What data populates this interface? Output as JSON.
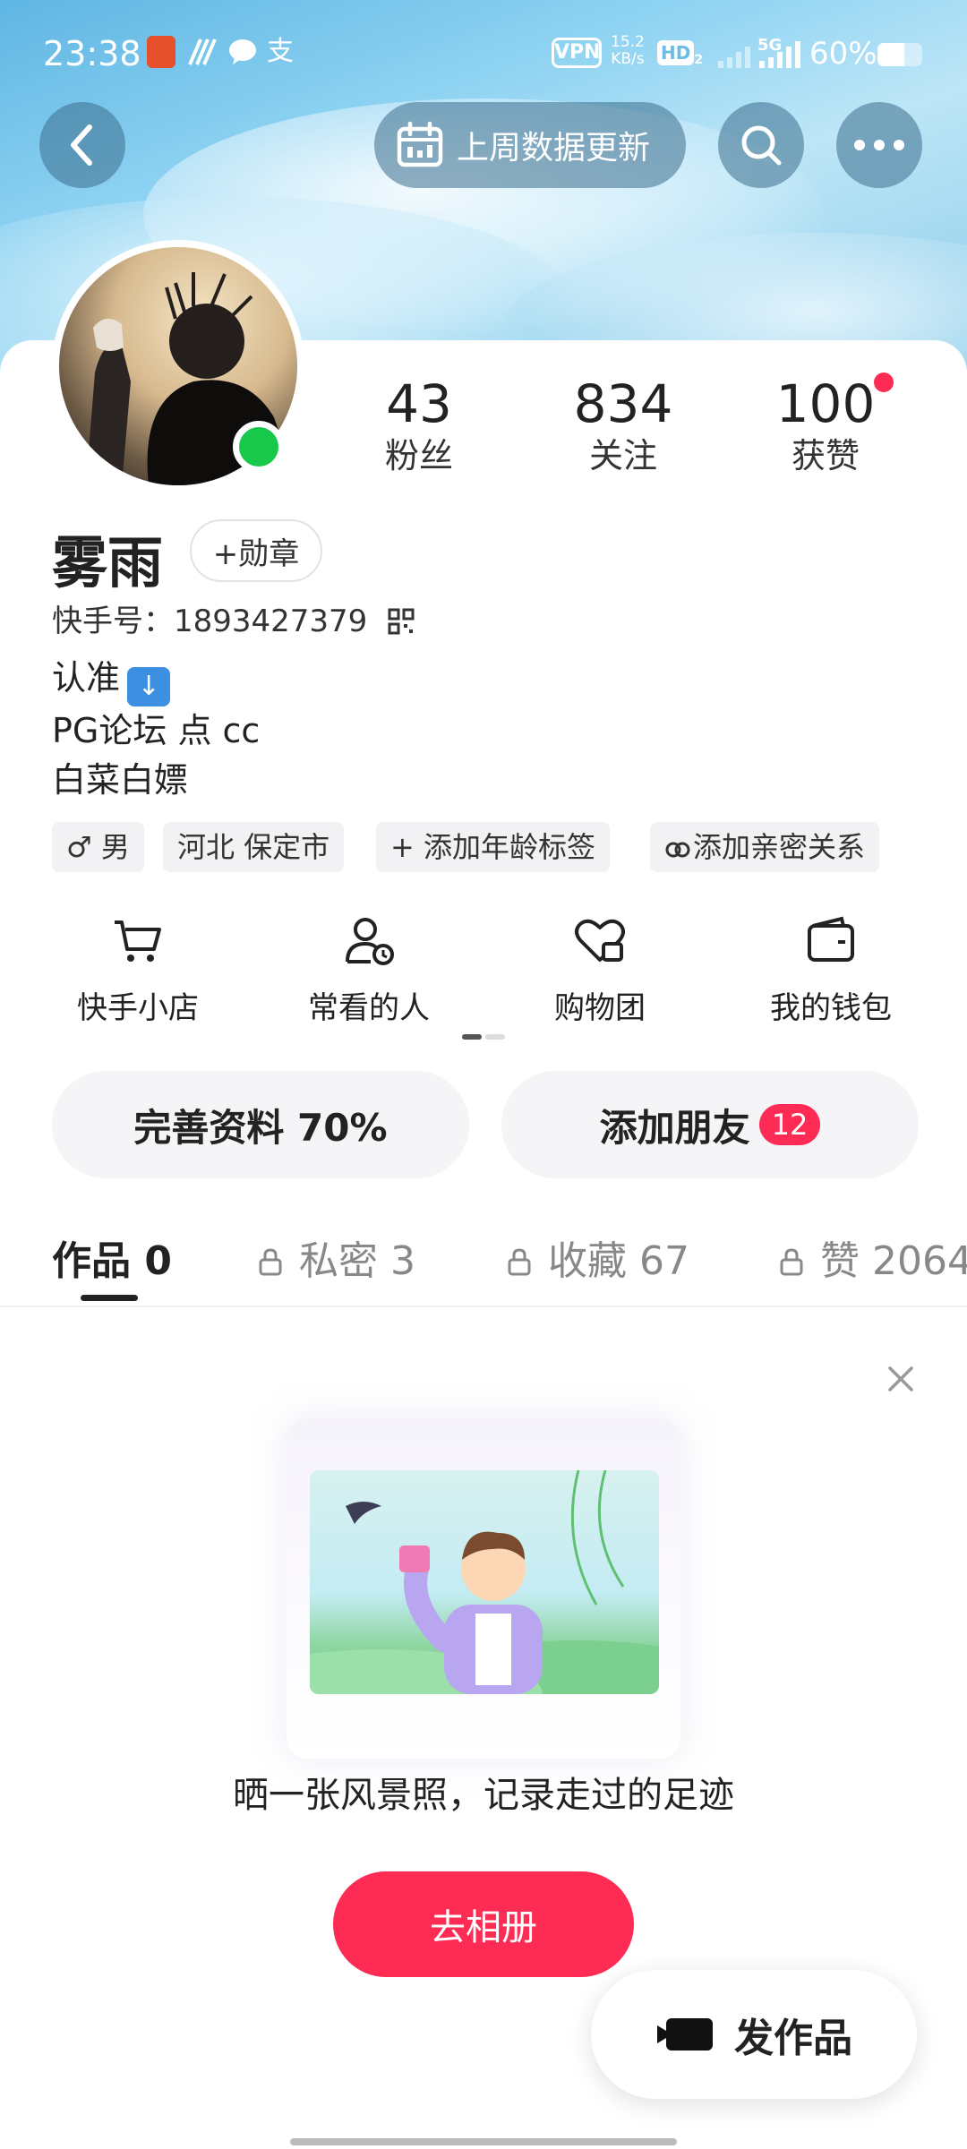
{
  "status_bar": {
    "time": "23:38",
    "vpn": "VPN",
    "net_speed_value": "15.2",
    "net_speed_unit": "KB/s",
    "hd": "HD",
    "hd_sub": "2",
    "signal_label": "5G",
    "battery_text": "60%",
    "battery_level": 0.6
  },
  "header": {
    "data_update_label": "上周数据更新"
  },
  "profile": {
    "name": "雾雨",
    "medal_label": "+勋章",
    "kuaishou_id_label": "快手号：1893427379",
    "bio_lines": [
      "认准",
      "PG论坛 点 cc",
      "白菜白嫖"
    ],
    "online": true
  },
  "stats": {
    "fans": {
      "value": "43",
      "label": "粉丝"
    },
    "following": {
      "value": "834",
      "label": "关注"
    },
    "likes": {
      "value": "100",
      "label": "获赞"
    }
  },
  "tags": {
    "gender": "♂ 男",
    "city": "河北 保定市",
    "age": "+ 添加年龄标签",
    "relation": "添加亲密关系"
  },
  "quick_actions": [
    {
      "label": "快手小店",
      "icon": "cart-icon"
    },
    {
      "label": "常看的人",
      "icon": "person-clock-icon"
    },
    {
      "label": "购物团",
      "icon": "heart-bag-icon"
    },
    {
      "label": "我的钱包",
      "icon": "wallet-icon"
    }
  ],
  "pills": {
    "complete_profile": "完善资料 70%",
    "add_friends": "添加朋友",
    "add_friends_badge": "12"
  },
  "tabs": [
    {
      "label": "作品 0",
      "active": true,
      "locked": false
    },
    {
      "label": "私密 3",
      "active": false,
      "locked": true
    },
    {
      "label": "收藏 67",
      "active": false,
      "locked": true
    },
    {
      "label": "赞 2064",
      "active": false,
      "locked": true
    }
  ],
  "empty_state": {
    "text": "晒一张风景照，记录走过的足迹",
    "button": "去相册"
  },
  "publish": {
    "label": "发作品"
  },
  "colors": {
    "accent": "#fe2c55",
    "online": "#18c84b"
  }
}
